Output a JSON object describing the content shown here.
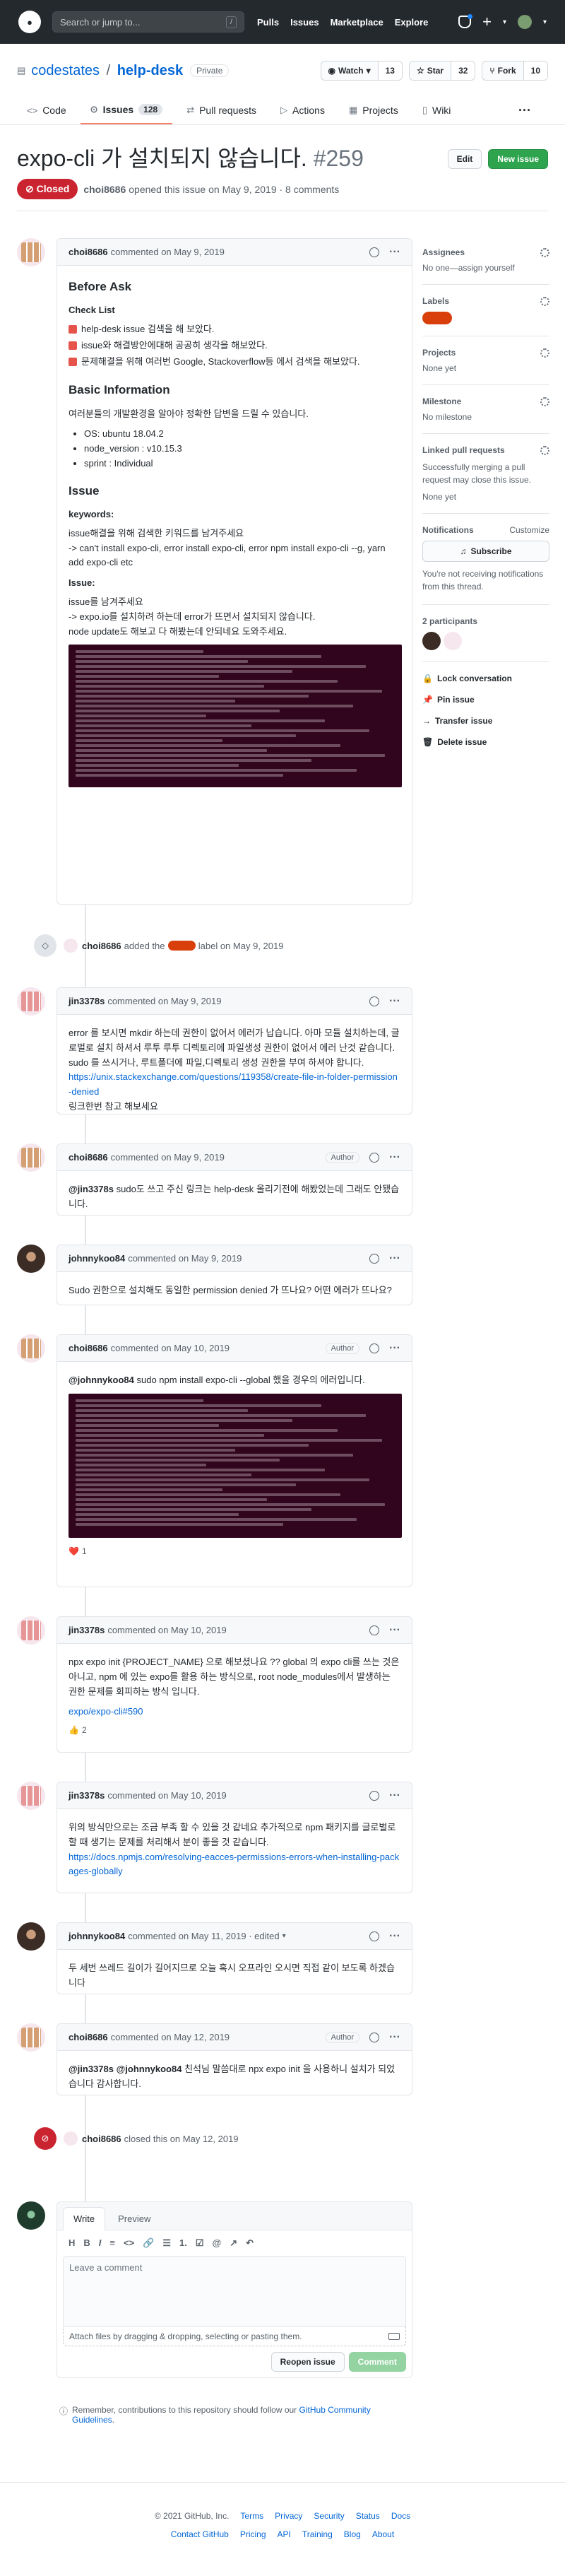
{
  "header": {
    "search_placeholder": "Search or jump to...",
    "slash_key": "/",
    "nav": [
      "Pulls",
      "Issues",
      "Marketplace",
      "Explore"
    ],
    "plus": "+",
    "caret": "▾"
  },
  "repo": {
    "owner": "codestates",
    "separator": "/",
    "name": "help-desk",
    "visibility": "Private",
    "watch_label": "Watch",
    "watch_count": "13",
    "star_label": "Star",
    "star_count": "32",
    "fork_label": "Fork",
    "fork_count": "10",
    "tabs": [
      {
        "label": "Code"
      },
      {
        "label": "Issues",
        "count": "128"
      },
      {
        "label": "Pull requests"
      },
      {
        "label": "Actions"
      },
      {
        "label": "Projects"
      },
      {
        "label": "Wiki"
      }
    ],
    "more": "···"
  },
  "issue": {
    "title": "expo-cli 가 설치되지 않습니다.",
    "number": "#259",
    "edit_label": "Edit",
    "new_issue_label": "New issue",
    "state": "Closed",
    "author": "choi8686",
    "opened_text": "opened this issue on May 9, 2019 · 8 comments"
  },
  "first_comment": {
    "author": "choi8686",
    "date_text": "commented on May 9, 2019",
    "h_before": "Before Ask",
    "h_checklist": "Check List",
    "checklist": [
      "help-desk issue 검색을 해 보았다.",
      "issue와 해결방안에대해 공공히 생각을 해보았다.",
      "문제해결을 위해 여러번 Google, Stackoverflow등 에서 검색을 해보았다."
    ],
    "h_basic": "Basic Information",
    "basic_intro": "여러분들의 개발환경을 알아야 정확한 답변을 드릴 수 있습니다.",
    "env": [
      "OS: ubuntu 18.04.2",
      "node_version : v10.15.3",
      "sprint : Individual"
    ],
    "h_issue": "Issue",
    "h_keywords": "keywords:",
    "keywords_text": "issue해결을 위해 검색한 키워드를 남겨주세요",
    "keywords_detail": "-> can't install expo-cli, error install expo-cli, error npm install expo-cli --g, yarn add expo-cli etc",
    "h_issue2": "Issue:",
    "issue_text": "issue를 남겨주세요",
    "issue_detail": "-> expo.io를 설치하려 하는데 error가 뜨면서 설치되지 않습니다.",
    "issue_detail2": "node update도 해보고 다 해봤는데 안되네요 도와주세요."
  },
  "label_event": {
    "author": "choi8686",
    "added_the": "added the",
    "label": "label",
    "suffix": "label on May 9, 2019"
  },
  "comments": [
    {
      "author": "jin3378s",
      "date_text": "commented on May 9, 2019",
      "body": "error 를 보시면 mkdir 하는데 권한이 없어서 에러가 납습니다. 아마 모듈 설치하는데, 글로벌로 설치 하셔서 루투 루투 디렉토리에 파일생성 권한이 없어서 에러 난것 같습니다. sudo 를 쓰시거나, 루트폴더에 파일,디렉토리 생성 권한을 부여 하셔야 합니다.",
      "link": "https://unix.stackexchange.com/questions/119358/create-file-in-folder-permission-denied",
      "extra": "링크한번 참고 해보세요"
    },
    {
      "author": "choi8686",
      "date_text": "commented on May 9, 2019",
      "role": "Author",
      "mention": "@jin3378s",
      "body": "sudo도 쓰고 주신 링크는 help-desk 올리기전에 해봤었는데 그래도 안됐습니다."
    },
    {
      "author": "johnnykoo84",
      "date_text": "commented on May 9, 2019",
      "body": "Sudo 권한으로 설치해도 동일한 permission denied 가 뜨나요? 어떤 에러가 뜨나요?"
    },
    {
      "author": "choi8686",
      "date_text": "commented on May 10, 2019",
      "role": "Author",
      "mention": "@johnnykoo84",
      "body": "sudo npm install expo-cli --global 했을 경우의 에러입니다.",
      "reaction_icon": "❤️",
      "reaction_count": "1"
    },
    {
      "author": "jin3378s",
      "date_text": "commented on May 10, 2019",
      "body": "npx expo init {PROJECT_NAME} 으로 해보셨나요 ?? global 의 expo cli를 쓰는 것은 아니고, npm 에 있는 expo를 활용 하는 방식으로, root node_modules에서 발생하는 권한 문제를 회피하는 방식 입니다.",
      "link": "expo/expo-cli#590",
      "reaction_icon": "👍",
      "reaction_count": "2"
    },
    {
      "author": "jin3378s",
      "date_text": "commented on May 10, 2019",
      "body": "위의 방식만으로는 조금 부족 할 수 있을 것 같네요 추가적으로 npm 패키지를 글로벌로 할 때 생기는 문제를 처리해서 분이 좋을 것 같습니다.",
      "link": "https://docs.npmjs.com/resolving-eacces-permissions-errors-when-installing-packages-globally"
    },
    {
      "author": "johnnykoo84",
      "date_text": "commented on May 11, 2019 · edited",
      "edited_caret": "▾",
      "body": "두 세번 쓰레드 길이가 길어지므로 오늘 혹시 오프라인 오시면 직접 같이 보도록 하겠습니다"
    },
    {
      "author": "choi8686",
      "date_text": "commented on May 12, 2019",
      "role": "Author",
      "mention": "@jin3378s @johnnykoo84",
      "body": "친석님 말씀대로 npx expo init 을 사용하니 설치가 되었습니다 감사합니다."
    }
  ],
  "close_event": {
    "author": "choi8686",
    "text": "closed this on May 12, 2019"
  },
  "sidebar": {
    "assignees_title": "Assignees",
    "assignees_value": "No one—assign yourself",
    "labels_title": "Labels",
    "projects_title": "Projects",
    "projects_value": "None yet",
    "milestone_title": "Milestone",
    "milestone_value": "No milestone",
    "linked_title": "Linked pull requests",
    "linked_desc": "Successfully merging a pull request may close this issue.",
    "linked_value": "None yet",
    "notifications_title": "Notifications",
    "customize": "Customize",
    "subscribe": "Subscribe",
    "notifications_desc": "You're not receiving notifications from this thread.",
    "participants_title": "2 participants",
    "actions": [
      "Lock conversation",
      "Pin issue",
      "Transfer issue",
      "Delete issue"
    ]
  },
  "composer": {
    "tab_write": "Write",
    "tab_preview": "Preview",
    "toolbar": [
      "H",
      "B",
      "I",
      "≡",
      "<>",
      "🔗",
      "☰",
      "1.",
      "☑",
      "@",
      "↗",
      "↶"
    ],
    "placeholder": "Leave a comment",
    "attach": "Attach files by dragging & dropping, selecting or pasting them.",
    "reopen": "Reopen issue",
    "comment": "Comment",
    "tip_prefix": "Remember, contributions to this repository should follow our",
    "tip_link": "GitHub Community Guidelines",
    "tip_suffix": "."
  },
  "footer": {
    "copyright": "© 2021 GitHub, Inc.",
    "row1": [
      "Terms",
      "Privacy",
      "Security",
      "Status",
      "Docs"
    ],
    "row2": [
      "Contact GitHub",
      "Pricing",
      "API",
      "Training",
      "Blog",
      "About"
    ]
  }
}
